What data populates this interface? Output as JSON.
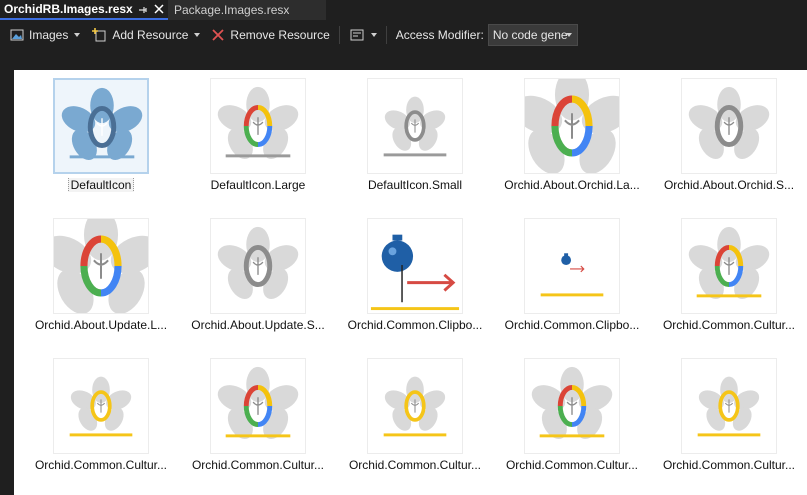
{
  "tabs": [
    {
      "label": "OrchidRB.Images.resx",
      "active": true
    },
    {
      "label": "Package.Images.resx",
      "active": false
    }
  ],
  "toolbar": {
    "images_label": "Images",
    "add_resource_label": "Add Resource",
    "remove_resource_label": "Remove Resource",
    "access_modifier_label": "Access Modifier:",
    "access_modifier_value": "No code gene"
  },
  "colors": {
    "orchid_blue": "#7aa9d1",
    "ring_red": "#db4437",
    "ring_yellow": "#f4c20d",
    "ring_green": "#4caf50",
    "ring_blue": "#4285f4",
    "petal_gray": "#d9d9d9",
    "ring_gray": "#8c8c8c",
    "culture_yellow": "#f5c518",
    "arrow_red": "#d64a43",
    "bulb_blue": "#1f5fa6",
    "selection": "#b5d2ec"
  },
  "resources": [
    {
      "name": "DefaultIcon",
      "style": "blue",
      "size": "medium",
      "underline": "#7aa9d1",
      "selected": true
    },
    {
      "name": "DefaultIcon.Large",
      "style": "color",
      "size": "medium",
      "underline": "#9a9a9a",
      "selected": false
    },
    {
      "name": "DefaultIcon.Small",
      "style": "gray",
      "size": "small",
      "underline": "#9a9a9a",
      "selected": false
    },
    {
      "name": "Orchid.About.Orchid.La...",
      "style": "color",
      "size": "large",
      "underline": null,
      "selected": false
    },
    {
      "name": "Orchid.About.Orchid.S...",
      "style": "gray",
      "size": "medium",
      "underline": null,
      "selected": false
    },
    {
      "name": "Orchid.About.Update.L...",
      "style": "color",
      "size": "large",
      "underline": null,
      "selected": false
    },
    {
      "name": "Orchid.About.Update.S...",
      "style": "gray",
      "size": "medium",
      "underline": null,
      "selected": false
    },
    {
      "name": "Orchid.Common.Clipbo...",
      "style": "clip-large",
      "size": "large",
      "underline": "#f5c518",
      "selected": false
    },
    {
      "name": "Orchid.Common.Clipbo...",
      "style": "clip-small",
      "size": "small",
      "underline": "#f5c518",
      "selected": false
    },
    {
      "name": "Orchid.Common.Cultur...",
      "style": "culture",
      "size": "medium",
      "underline": "#f5c518",
      "selected": false
    },
    {
      "name": "Orchid.Common.Cultur...",
      "style": "culture-yellow",
      "size": "small",
      "underline": "#f5c518",
      "selected": false
    },
    {
      "name": "Orchid.Common.Cultur...",
      "style": "culture",
      "size": "medium",
      "underline": "#f5c518",
      "selected": false
    },
    {
      "name": "Orchid.Common.Cultur...",
      "style": "culture-yellow",
      "size": "small",
      "underline": "#f5c518",
      "selected": false
    },
    {
      "name": "Orchid.Common.Cultur...",
      "style": "culture",
      "size": "medium",
      "underline": "#f5c518",
      "selected": false
    },
    {
      "name": "Orchid.Common.Cultur...",
      "style": "culture-yellow",
      "size": "small",
      "underline": "#f5c518",
      "selected": false
    }
  ]
}
